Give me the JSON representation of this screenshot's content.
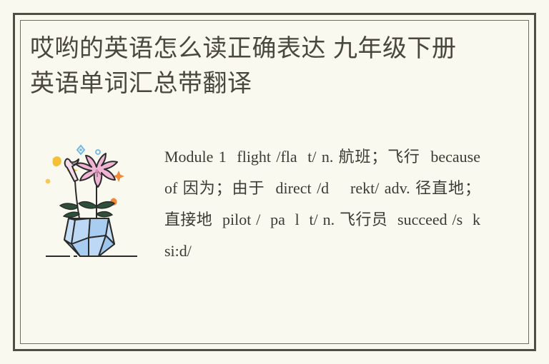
{
  "page": {
    "background_color": "#faf9ef",
    "frame_outer_color": "#4f4f43",
    "frame_inner_color": "#6e6e5f"
  },
  "article": {
    "title": "哎哟的英语怎么读正确表达 九年级下册英语单词汇总带翻译",
    "title_color": "#49483c",
    "body": "Module 1  flight /fla  t/ n. 航班；飞行  because of 因为；由于  direct /d    rekt/ adv. 径直地；直接地  pilot /  pa  l  t/ n. 飞行员  succeed /s  k  si:d/",
    "body_color": "#3b3b35"
  },
  "illustration": {
    "name": "flowers-in-vase-illustration",
    "vase_fill": "#a8cdf0",
    "vase_fill_light": "#c5ddf5",
    "vase_stroke": "#2b2b2b",
    "flower_fill": "#efb4d4",
    "flower_stroke": "#2b2b2b",
    "leaf_fill": "#2f4f3a",
    "ground_line_color": "#2b2b2b",
    "sparkles": [
      {
        "name": "blue-diamond-sparkle",
        "color": "#6fb7e8"
      },
      {
        "name": "blue-dot-sparkle",
        "color": "#6fb7e8"
      },
      {
        "name": "yellow-blob-sparkle",
        "color": "#f5c039"
      },
      {
        "name": "yellow-star-sparkle",
        "color": "#f5c039"
      },
      {
        "name": "orange-star-sparkle",
        "color": "#f08a3c"
      },
      {
        "name": "orange-dot-sparkle",
        "color": "#f08a3c"
      }
    ]
  }
}
